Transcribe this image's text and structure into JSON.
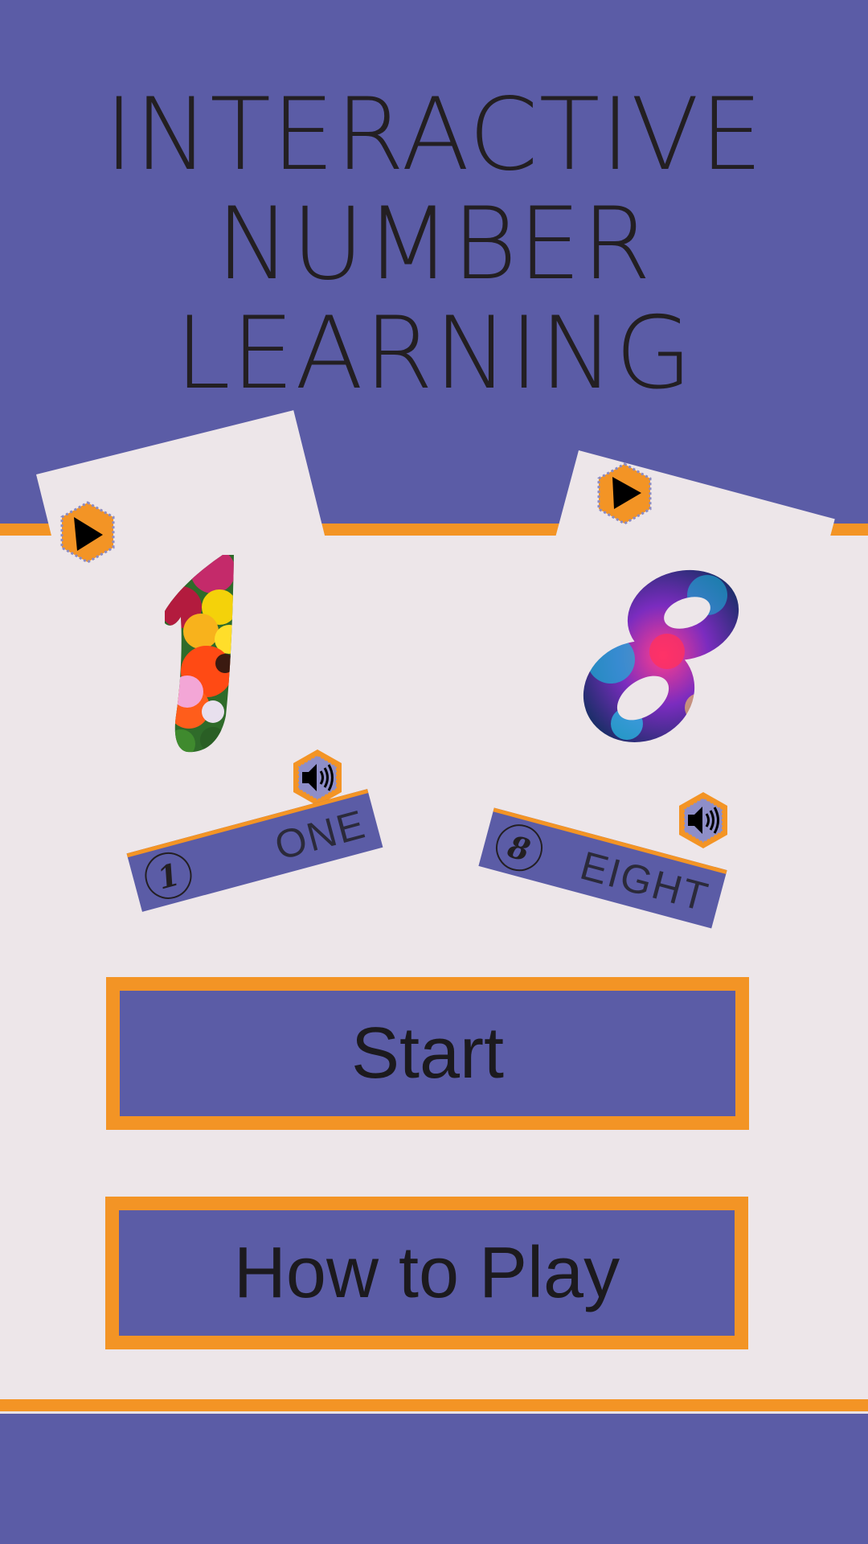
{
  "title": {
    "line1": "INTERACTIVE",
    "line2": "NUMBER",
    "line3": "LEARNING"
  },
  "cards": [
    {
      "digit": "1",
      "word": "ONE",
      "art": "flower-filled-numeral"
    },
    {
      "digit": "8",
      "word": "EIGHT",
      "art": "sparkle-filled-numeral"
    }
  ],
  "buttons": {
    "start": "Start",
    "how_to_play": "How to Play"
  },
  "icons": {
    "play": "play-icon",
    "speaker": "speaker-icon"
  },
  "colors": {
    "purple": "#5b5ca6",
    "orange": "#f39425",
    "background": "#ede6e9",
    "text": "#231f22"
  }
}
